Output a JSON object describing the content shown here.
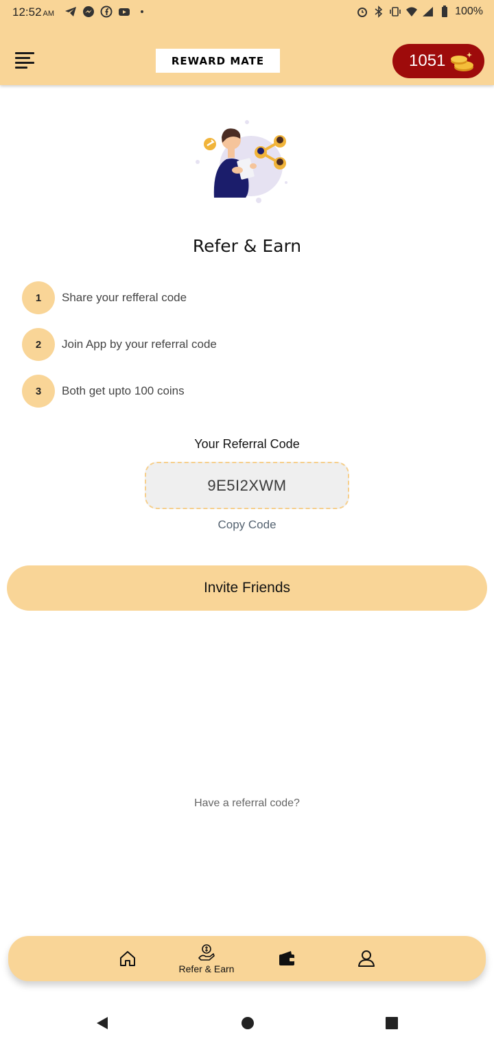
{
  "status_bar": {
    "time": "12:52",
    "ampm": "AM",
    "battery": "100%"
  },
  "app_bar": {
    "brand": "REWARD MATE",
    "coins": "1051"
  },
  "main": {
    "title": "Refer & Earn",
    "steps": [
      {
        "num": "1",
        "text": "Share your refferal code"
      },
      {
        "num": "2",
        "text": "Join App by your referral code"
      },
      {
        "num": "3",
        "text": "Both get upto 100 coins"
      }
    ],
    "referral_label": "Your Referral Code",
    "referral_code": "9E5I2XWM",
    "copy_code": "Copy Code",
    "invite_button": "Invite Friends",
    "have_code": "Have a referral code?"
  },
  "bottom_nav": {
    "items": [
      {
        "icon": "home-icon",
        "label": ""
      },
      {
        "icon": "refer-earn-icon",
        "label": "Refer & Earn"
      },
      {
        "icon": "wallet-icon",
        "label": ""
      },
      {
        "icon": "profile-icon",
        "label": ""
      }
    ]
  },
  "colors": {
    "accent": "#f9d597",
    "coin_pill": "#9e0b0b"
  }
}
